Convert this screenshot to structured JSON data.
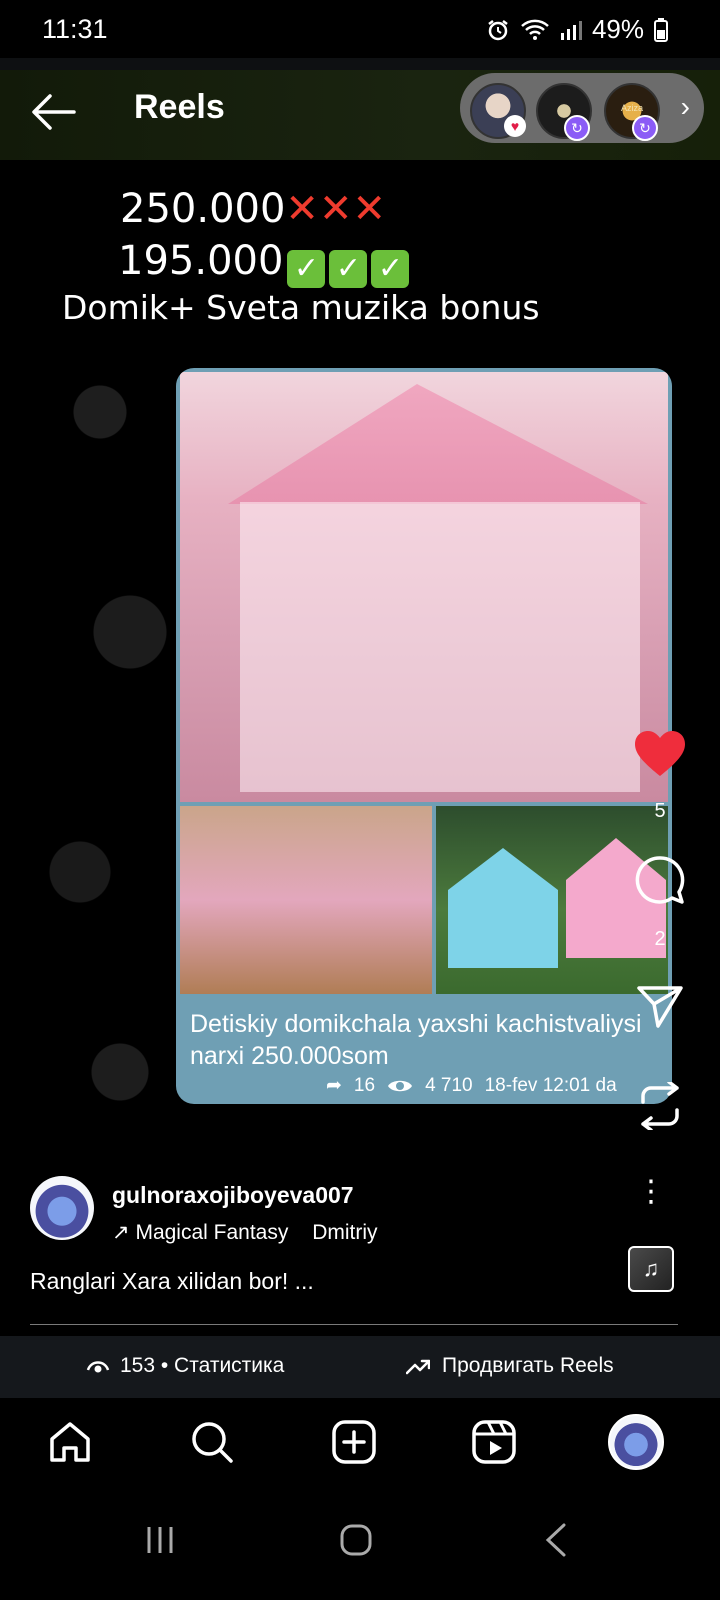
{
  "status_bar": {
    "time": "11:31",
    "battery": "49%"
  },
  "header": {
    "title": "Reels",
    "story_labels": [
      "",
      "",
      "Aziza"
    ]
  },
  "reel": {
    "price_old": "250.000",
    "price_new": "195.000",
    "promo": "Domik+ Sveta muzika bonus",
    "card_text": "Detiskiy domikchala yaxshi kachistvaliysi narxi 250.000som",
    "card_meta": {
      "shares": "16",
      "views": "4 710",
      "date": "18-fev 12:01 da"
    }
  },
  "actions": {
    "likes": "5",
    "comments": "2"
  },
  "user": {
    "username": "gulnoraxojiboyeva007",
    "music": "Magical Fantasy",
    "music_artist": "Dmitriy",
    "caption": "Ranglari Xara xilidan bor! ..."
  },
  "stats": {
    "views_text": "153 • Статистика",
    "promote_text": "Продвигать Reels"
  },
  "colors": {
    "like_red": "#ef2d3c",
    "card_blue": "#6f9fb4"
  }
}
